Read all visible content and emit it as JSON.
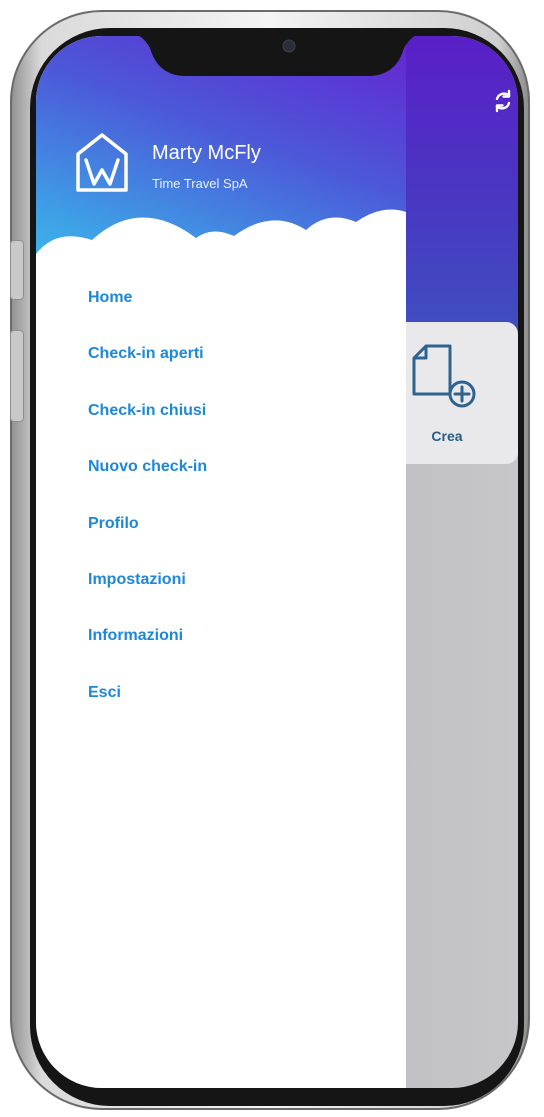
{
  "drawer": {
    "user_name": "Marty McFly",
    "company": "Time Travel SpA",
    "logo_icon": "house-w-logo-icon",
    "menu": [
      {
        "label": "Home"
      },
      {
        "label": "Check-in aperti"
      },
      {
        "label": "Check-in chiusi"
      },
      {
        "label": "Nuovo check-in"
      },
      {
        "label": "Profilo"
      },
      {
        "label": "Impostazioni"
      },
      {
        "label": "Informazioni"
      },
      {
        "label": "Esci"
      }
    ]
  },
  "main": {
    "sync_icon": "sync-icon",
    "create_card": {
      "label": "Crea",
      "icon": "new-document-icon"
    }
  },
  "colors": {
    "menu_text": "#1e88d8",
    "header_top": "#6524d1",
    "header_bottom": "#3cc4ec",
    "create_label": "#2b5c86"
  }
}
